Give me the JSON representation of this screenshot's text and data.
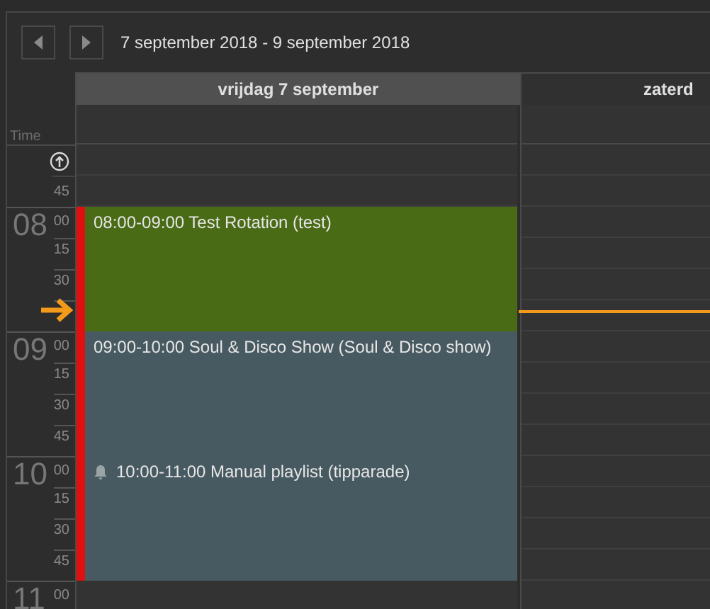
{
  "date_range": "7 september 2018 - 9 september 2018",
  "days": [
    {
      "label": "vrijdag 7 september",
      "selected": true
    },
    {
      "label": "zaterd",
      "selected": false
    }
  ],
  "time_label": "Time",
  "pre_slots": [
    {
      "kind": "scroll-up"
    },
    {
      "kind": "minute",
      "label": "45"
    }
  ],
  "hours": [
    {
      "hour": "08",
      "minutes": [
        "00",
        "15",
        "30"
      ]
    },
    {
      "hour": "09",
      "minutes": [
        "00",
        "15",
        "30",
        "45"
      ]
    },
    {
      "hour": "10",
      "minutes": [
        "00",
        "15",
        "30",
        "45"
      ]
    },
    {
      "hour": "11",
      "minutes": [
        "00"
      ]
    }
  ],
  "events": [
    {
      "time": "08:00-09:00",
      "title": "Test Rotation (test)",
      "color": "#4a6b16",
      "bell": false
    },
    {
      "time": "09:00-10:00",
      "title": "Soul & Disco Show (Soul & Disco show)",
      "color": "#485a61",
      "bell": false
    },
    {
      "time": "10:00-11:00",
      "title": "Manual playlist (tipparade)",
      "color": "#485a61",
      "bell": true
    }
  ]
}
